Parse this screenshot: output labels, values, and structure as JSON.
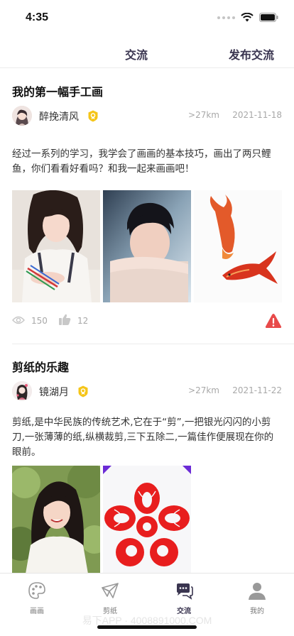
{
  "status_bar": {
    "time": "4:35"
  },
  "nav": {
    "title": "交流",
    "action": "发布交流"
  },
  "posts": [
    {
      "title": "我的第一幅手工画",
      "author": "醉挽清风",
      "distance": ">27km",
      "date": "2021-11-18",
      "body": "经过一系列的学习，我学会了画画的基本技巧，画出了两只鲤鱼，你们看看好看吗？和我一起来画画吧！",
      "views": "150",
      "likes": "12"
    },
    {
      "title": "剪纸的乐趣",
      "author": "镜湖月",
      "distance": ">27km",
      "date": "2021-11-22",
      "body": "剪纸,是中华民族的传统艺术,它在于“剪”,一把银光闪闪的小剪刀,一张薄薄的纸,纵横裁剪,三下五除二,一篇佳作便展现在你的眼前。"
    }
  ],
  "tabs": [
    {
      "label": "画画",
      "icon": "palette-icon"
    },
    {
      "label": "剪纸",
      "icon": "paper-plane-icon"
    },
    {
      "label": "交流",
      "icon": "chat-icon",
      "active": true
    },
    {
      "label": "我的",
      "icon": "user-icon"
    }
  ],
  "watermark": "易下APP · 4008891000.COM",
  "colors": {
    "accent": "#3a3550",
    "badge": "#f5c518",
    "report": "#e84a4a",
    "muted": "#a8a8a8"
  }
}
